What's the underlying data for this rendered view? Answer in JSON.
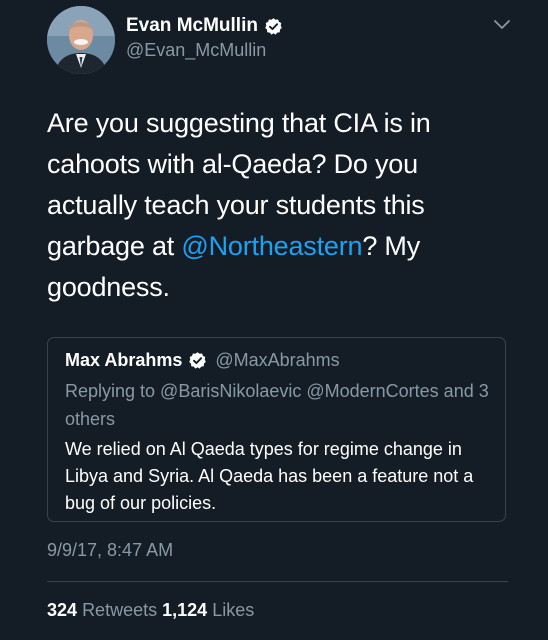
{
  "tweet": {
    "author": {
      "name": "Evan McMullin",
      "handle": "@Evan_McMullin"
    },
    "text_parts": {
      "before_mention": "Are you suggesting that CIA is in cahoots with al-Qaeda? Do you actually teach your students this garbage at ",
      "mention": "@Northeastern",
      "after_mention": "? My goodness."
    },
    "quoted": {
      "name": "Max Abrahms",
      "handle": "@MaxAbrahms",
      "replying_to": "Replying to @BarisNikolaevic @ModernCortes and 3 others",
      "text": "We relied on Al Qaeda types for regime change in Libya and Syria. Al Qaeda has been a feature not a bug of our policies."
    },
    "timestamp": "9/9/17, 8:47 AM",
    "stats": {
      "retweets_count": "324",
      "retweets_label": "Retweets",
      "likes_count": "1,124",
      "likes_label": "Likes"
    }
  },
  "icons": {
    "verified": "verified-badge-icon",
    "menu": "chevron-down-icon"
  },
  "colors": {
    "background": "#141d26",
    "text": "#ffffff",
    "secondary_text": "#8899a6",
    "link": "#1da1f2",
    "border": "#38444d"
  }
}
